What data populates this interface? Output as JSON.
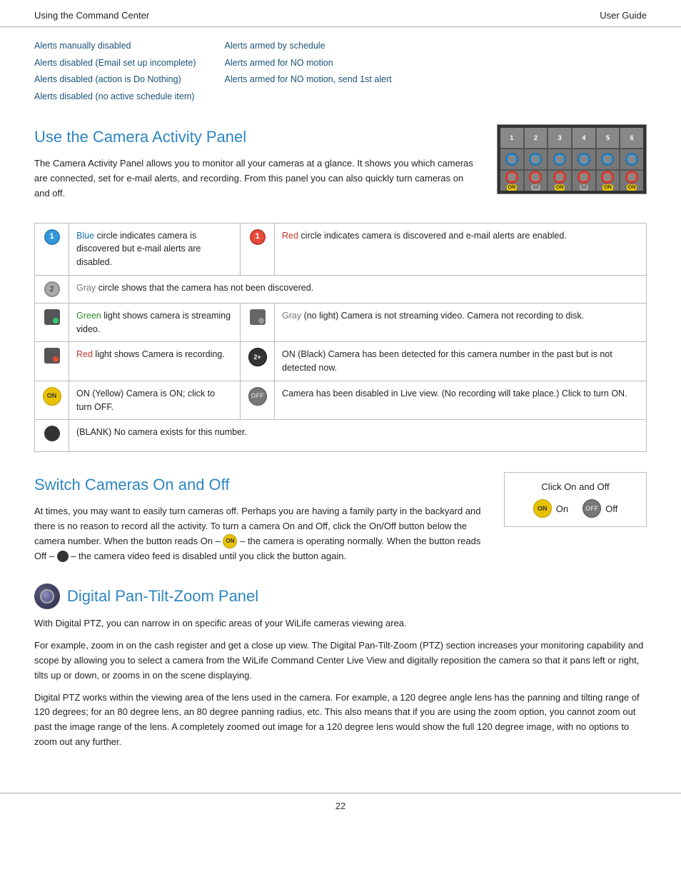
{
  "header": {
    "left": "Using the Command Center",
    "right": "User Guide"
  },
  "alerts": {
    "col1": [
      "Alerts manually disabled",
      "Alerts disabled (Email set up incomplete)",
      "Alerts disabled (action is Do Nothing)",
      "Alerts disabled (no active schedule item)"
    ],
    "col2": [
      "Alerts armed by schedule",
      "Alerts armed for NO motion",
      "Alerts armed for NO motion, send 1st alert"
    ]
  },
  "camera_activity": {
    "heading": "Use the Camera Activity Panel",
    "body": "The Camera Activity Panel allows you to monitor all your cameras at a glance. It shows you which cameras are connected, set for e-mail alerts, and recording. From this panel you can also quickly turn cameras on and off.",
    "legend": [
      {
        "left_icon": "blue-circle",
        "left_text_prefix": "Blue",
        "left_text": " circle indicates camera is discovered but e-mail alerts are disabled.",
        "right_icon": "red-circle",
        "right_text_prefix": "Red",
        "right_text": " circle indicates camera is discovered and e-mail alerts are enabled."
      },
      {
        "left_icon": "gray-circle",
        "left_text_prefix": "Gray",
        "left_text": " circle shows that the camera has not been discovered.",
        "right_icon": null,
        "right_text": ""
      },
      {
        "left_icon": "cam-green",
        "left_text_prefix": "Green",
        "left_text": " light shows camera is streaming video.",
        "right_icon": "cam-gray",
        "right_text_prefix": "Gray",
        "right_text": " (no light) Camera is not streaming video. Camera not recording to disk."
      },
      {
        "left_icon": "cam-red",
        "left_text_prefix": "Red",
        "left_text": " light shows Camera is recording.",
        "right_icon": "on-black",
        "right_text": "ON (Black) Camera has been detected for this camera number in the past but is not detected now."
      },
      {
        "left_icon": "on-yellow",
        "left_text": "ON (Yellow) Camera is ON; click to turn OFF.",
        "right_icon": "off-gray",
        "right_text": "Camera has been disabled in Live view. (No recording will take place.)  Click to turn ON."
      },
      {
        "left_icon": "blank",
        "left_text": "(BLANK) No camera exists for this number.",
        "right_icon": null,
        "right_text": ""
      }
    ]
  },
  "switch_cameras": {
    "heading": "Switch Cameras On and Off",
    "body1": "At times, you may want to easily turn cameras off. Perhaps you are having a family party in the backyard and there is no reason to record all the activity. To turn a camera On and Off, click the On/Off button below the camera number. When the button reads On –",
    "body2": "– the camera is operating normally. When the button reads Off –",
    "body3": "– the camera video feed is disabled until you click the button again.",
    "panel_title": "Click On and Off",
    "on_label": "On",
    "off_label": "Off"
  },
  "ptz": {
    "heading": "Digital Pan-Tilt-Zoom Panel",
    "intro": "With Digital PTZ, you can narrow in on specific areas of your WiLife cameras viewing area.",
    "para1": "For example, zoom in on the cash register and get a close up view. The Digital Pan-Tilt-Zoom (PTZ) section increases your monitoring capability and scope by allowing you to select a camera from the WiLife Command Center Live View and digitally reposition the camera so that it pans left or right, tilts up or down, or zooms in on the scene displaying.",
    "para2": "Digital PTZ works within the viewing area of the lens used in the camera. For example, a 120 degree angle lens has the panning and tilting range of 120 degrees; for an 80 degree lens, an 80 degree panning radius, etc. This also means that if you are using the zoom option, you cannot zoom out past the image range of the lens. A completely zoomed out image for a 120 degree lens would show the full 120 degree image, with no options to zoom out any further."
  },
  "footer": {
    "page_number": "22"
  }
}
